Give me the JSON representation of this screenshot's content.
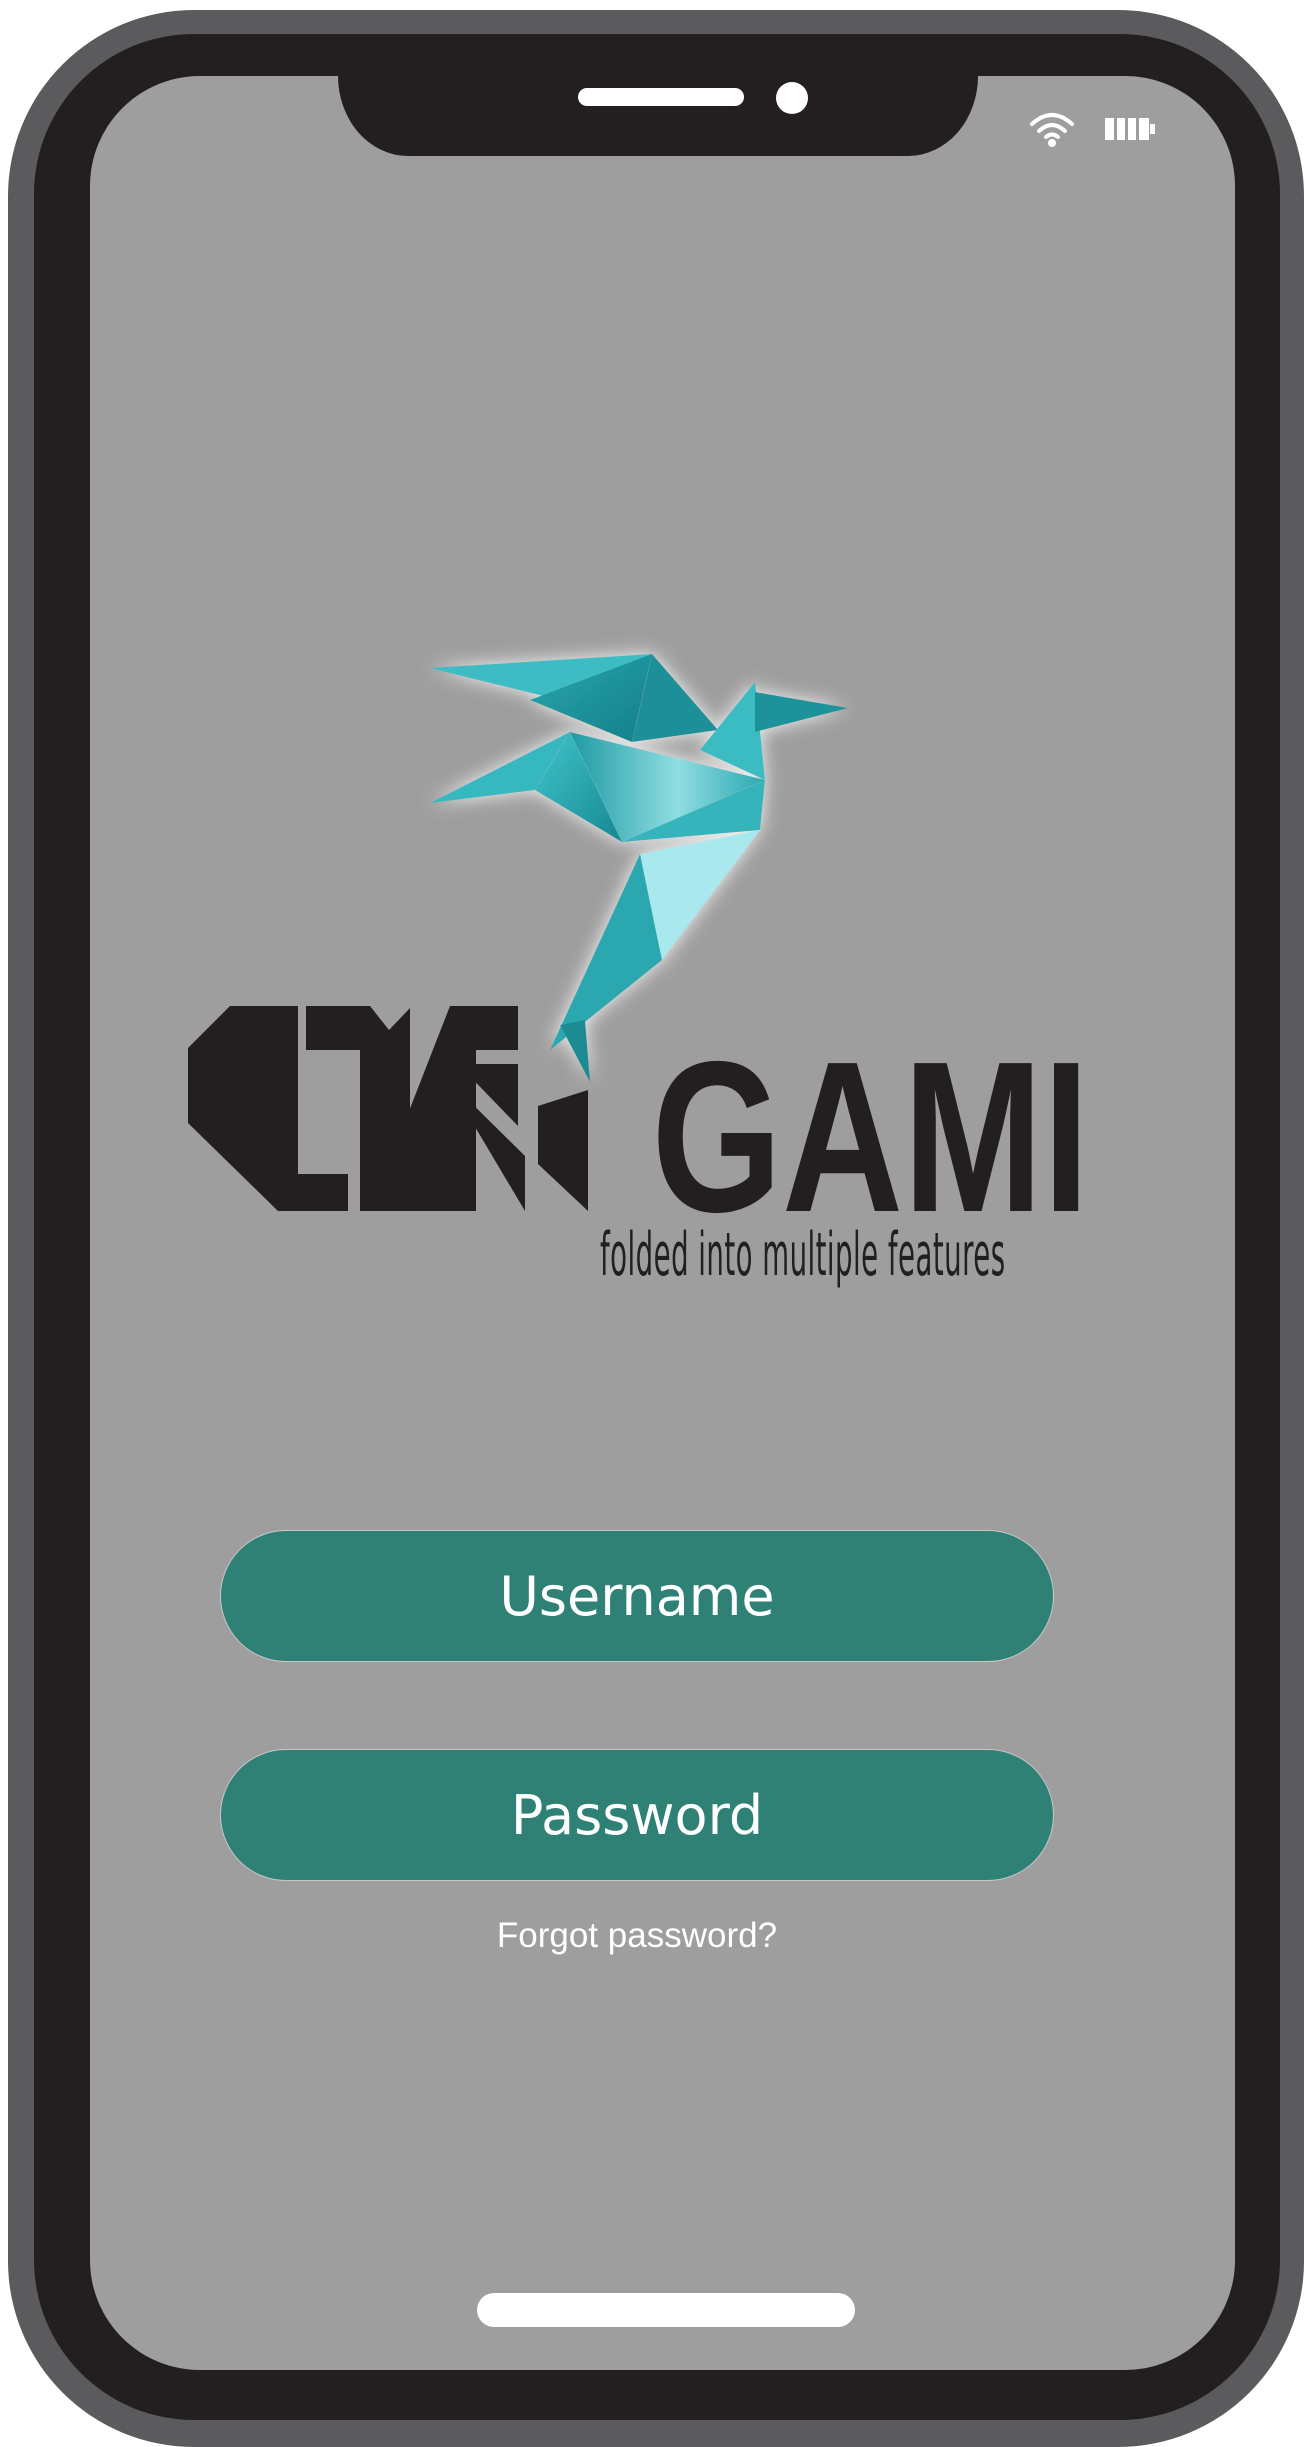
{
  "brand": {
    "name_left": "ORI",
    "name_right": "GAMI",
    "tagline": "folded into multiple features",
    "accent_color": "#3bb7bf",
    "field_color": "#2f8075"
  },
  "status_bar": {
    "icons": [
      "wifi-icon",
      "battery-icon"
    ]
  },
  "login": {
    "username_placeholder": "Username",
    "password_placeholder": "Password",
    "forgot_link": "Forgot password?"
  }
}
